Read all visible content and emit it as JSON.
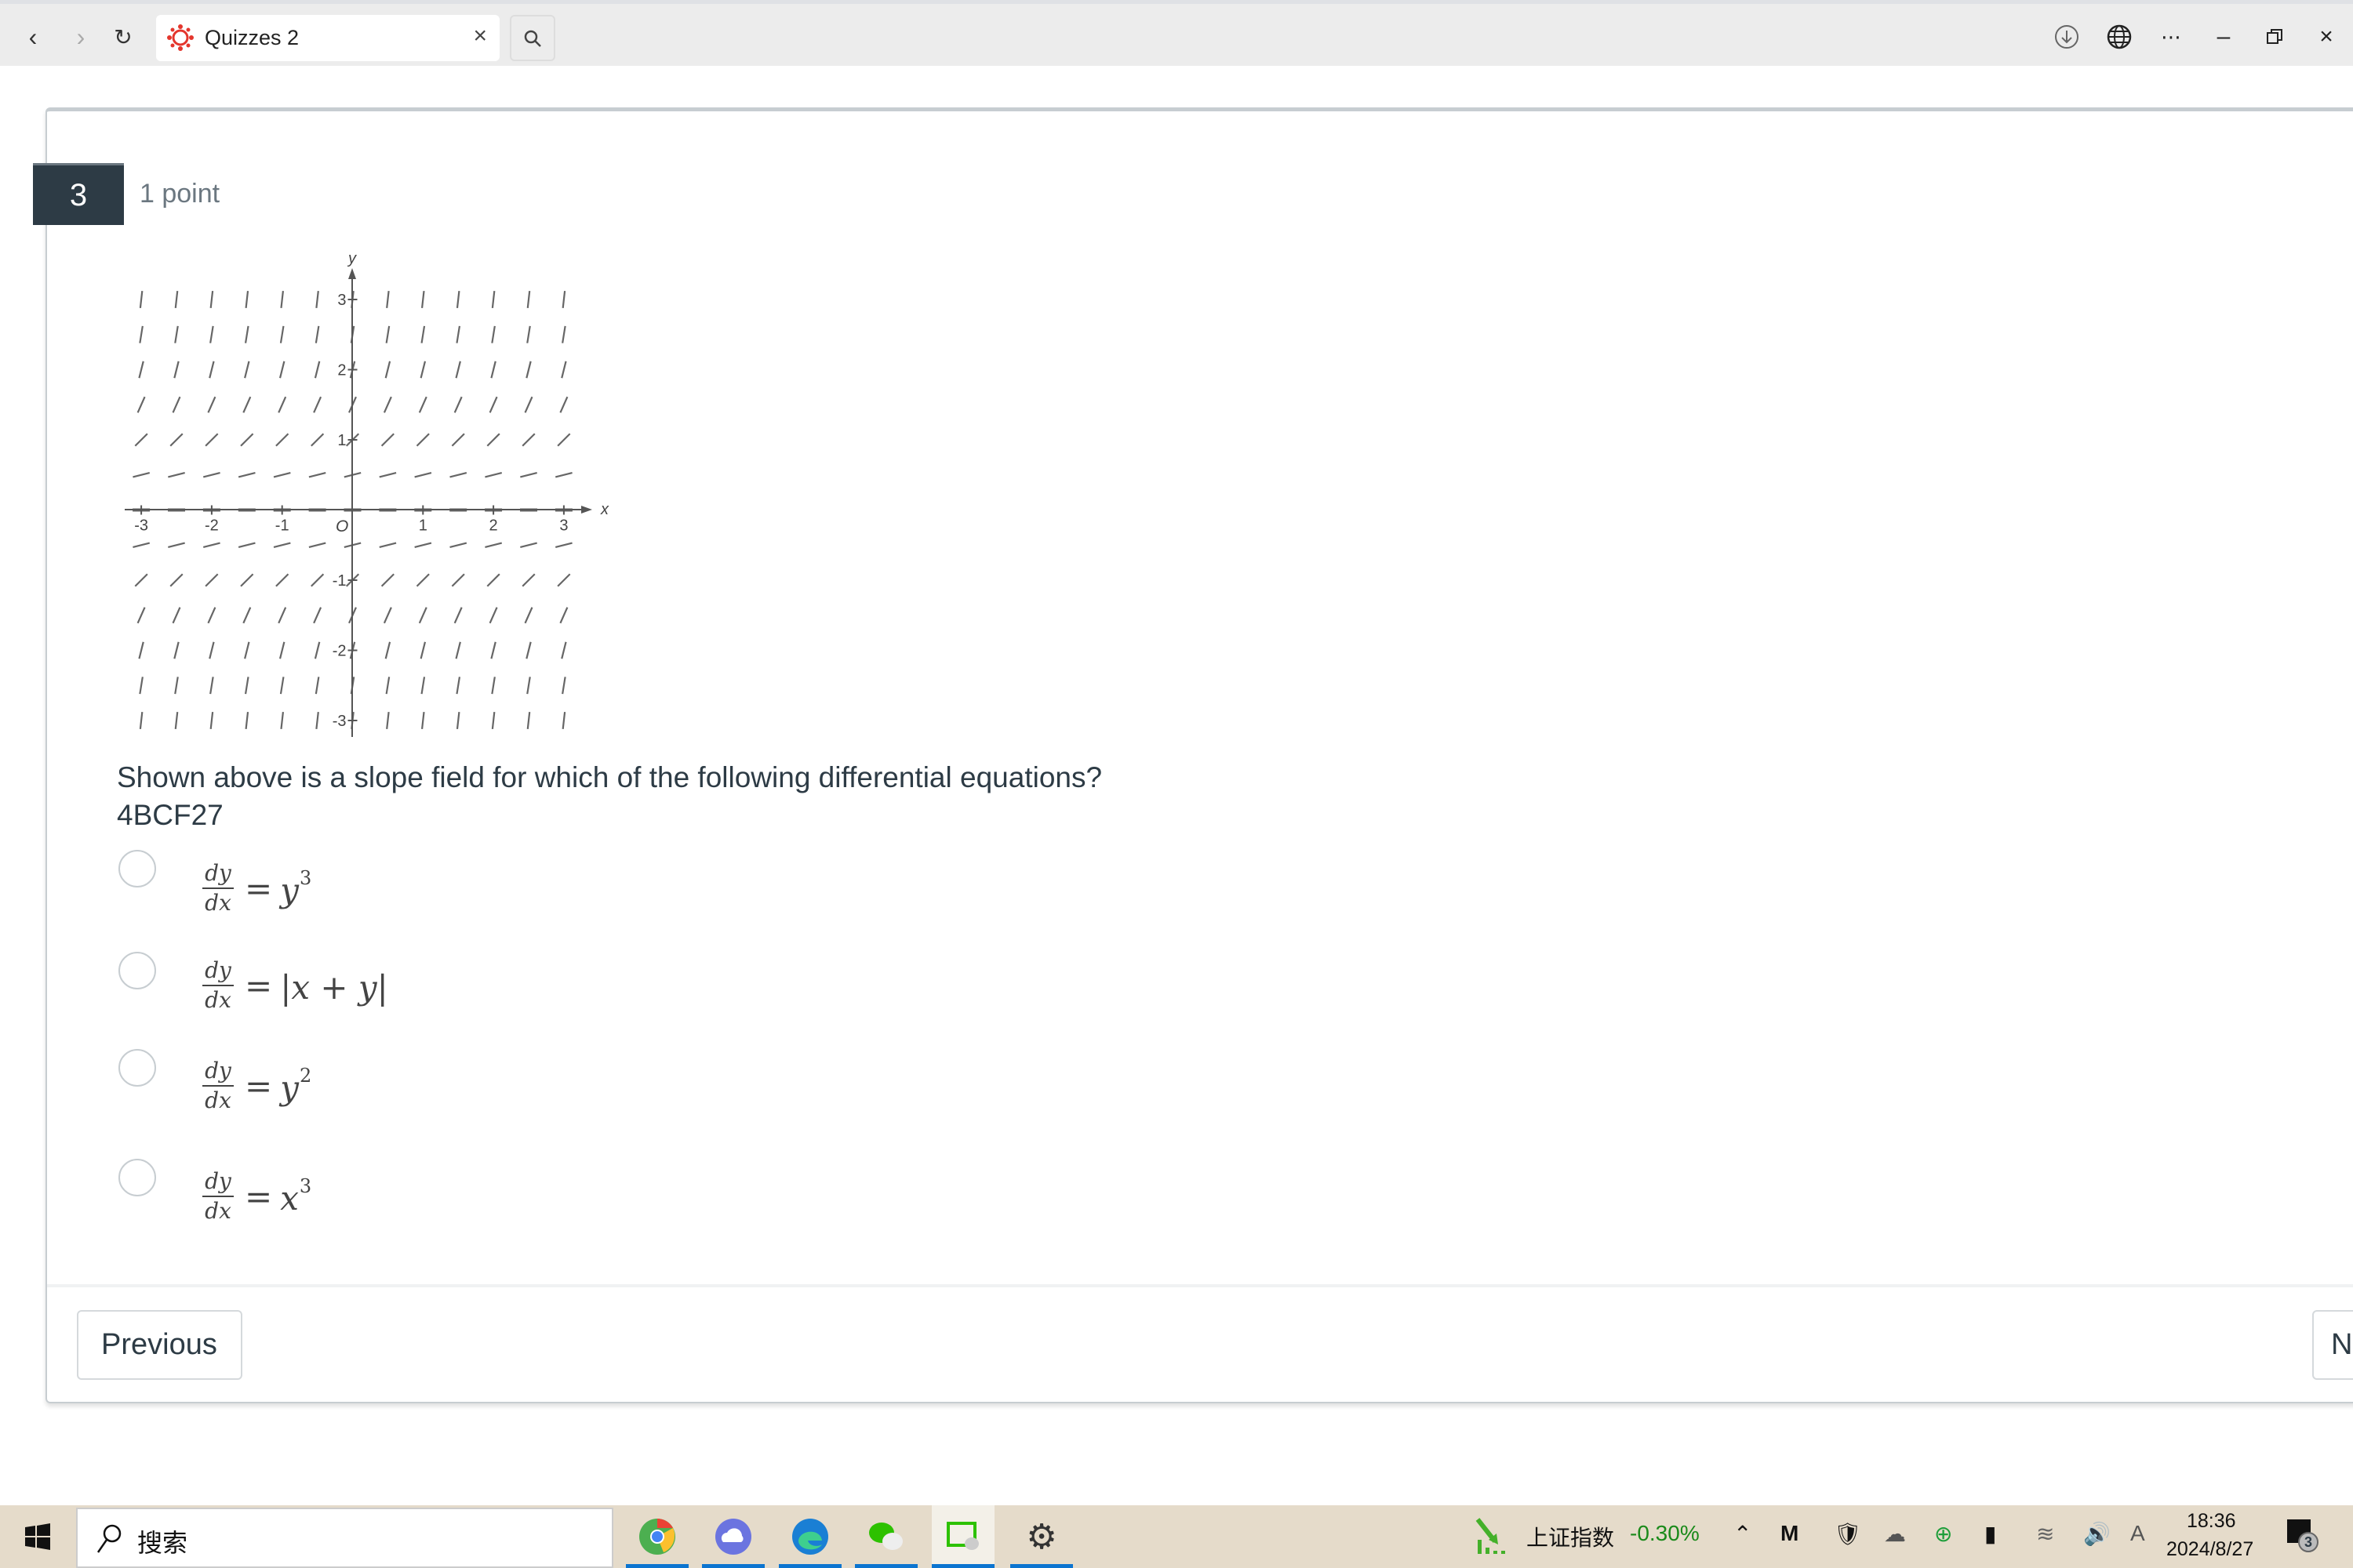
{
  "browser": {
    "tab_title": "Quizzes 2",
    "icons": [
      "back-icon",
      "forward-icon",
      "reload-icon",
      "canvas-logo-icon",
      "close-icon",
      "search-icon",
      "download-icon",
      "globe-icon",
      "more-icon",
      "minimize-icon",
      "restore-icon",
      "window-close-icon"
    ]
  },
  "question": {
    "number": "3",
    "points": "1 point",
    "text": "Shown above is a slope field for which of the following differential equations?",
    "code": "4BCF27",
    "options": [
      {
        "num": "dy",
        "den": "dx",
        "rhs": "y",
        "exp": "3",
        "selected": false
      },
      {
        "num": "dy",
        "den": "dx",
        "rhs": "|x + y|",
        "exp": "",
        "selected": false
      },
      {
        "num": "dy",
        "den": "dx",
        "rhs": "y",
        "exp": "2",
        "selected": false
      },
      {
        "num": "dy",
        "den": "dx",
        "rhs": "x",
        "exp": "3",
        "selected": false
      }
    ],
    "equals": "="
  },
  "chart_data": {
    "type": "slope-field",
    "xlabel": "x",
    "ylabel": "y",
    "origin_label": "O",
    "xlim": [
      -3,
      3
    ],
    "ylim": [
      -3,
      3
    ],
    "x_ticks": [
      "-3",
      "-2",
      "-1",
      "1",
      "2",
      "3"
    ],
    "y_ticks": [
      "3",
      "2",
      "1",
      "-1",
      "-2",
      "-3"
    ],
    "grid_step": 0.5,
    "slopes_by_y": [
      {
        "y": 3,
        "slope": 9
      },
      {
        "y": 2.5,
        "slope": 6.25
      },
      {
        "y": 2,
        "slope": 4
      },
      {
        "y": 1.5,
        "slope": 2.25
      },
      {
        "y": 1,
        "slope": 1
      },
      {
        "y": 0.5,
        "slope": 0.25
      },
      {
        "y": 0,
        "slope": 0
      },
      {
        "y": -0.5,
        "slope": 0.25
      },
      {
        "y": -1,
        "slope": 1
      },
      {
        "y": -1.5,
        "slope": 2.25
      },
      {
        "y": -2,
        "slope": 4
      },
      {
        "y": -2.5,
        "slope": 6.25
      },
      {
        "y": -3,
        "slope": 9
      }
    ]
  },
  "footer": {
    "previous": "Previous",
    "next": "Next"
  },
  "taskbar": {
    "search_placeholder": "搜索",
    "stock_name": "上证指数",
    "stock_change": "-0.30%",
    "stock_color": "#1a8a1a",
    "time": "18:36",
    "date": "2024/8/27",
    "notifications": "3",
    "ime": "A",
    "apps": [
      "chrome-icon",
      "cloud-app-icon",
      "edge-icon",
      "wechat-icon",
      "wechat-window-icon",
      "settings-icon"
    ]
  }
}
